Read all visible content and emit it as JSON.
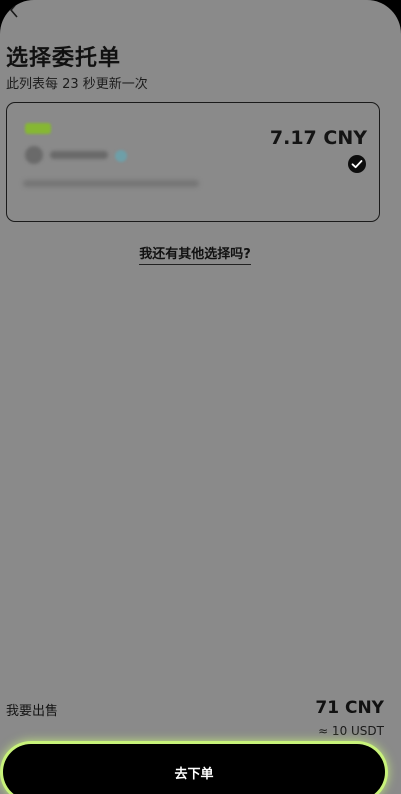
{
  "header": {
    "back_icon": "chevron-left-icon",
    "title": "选择委托单",
    "subtitle": "此列表每 23 秒更新一次"
  },
  "offer_card": {
    "price": "7.17 CNY",
    "selected": true,
    "check_icon": "check-circle-icon"
  },
  "other_options_link": "我还有其他选择吗?",
  "summary": {
    "sell_label": "我要出售",
    "sell_amount": "71 CNY",
    "sell_usdt": "≈ 10 USDT"
  },
  "submit_button": {
    "label": "去下单",
    "glow_color": "#c8f27a"
  }
}
